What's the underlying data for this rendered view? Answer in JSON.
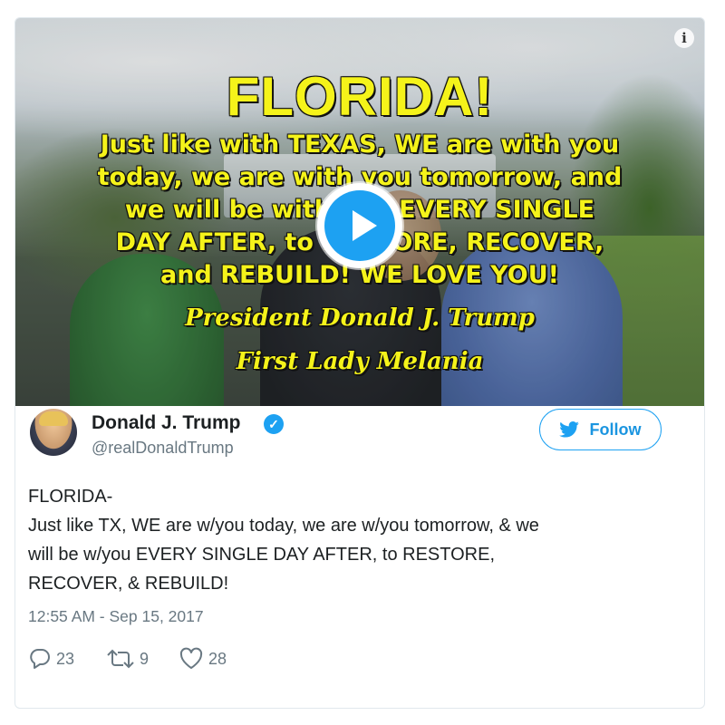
{
  "media": {
    "overlay_title": "FLORIDA!",
    "overlay_lines": [
      "Just like with TEXAS, WE are with you",
      "today, we are with you tomorrow, and",
      "we will be with you EVERY SINGLE",
      "DAY AFTER, to RESTORE, RECOVER,",
      "and REBUILD! WE LOVE YOU!"
    ],
    "overlay_signatures": [
      "President Donald J. Trump",
      "First Lady Melania"
    ],
    "info_icon": "info-icon",
    "play_icon": "play-icon"
  },
  "author": {
    "display_name": "Donald J. Trump",
    "handle": "@realDonaldTrump",
    "verified_icon": "verified-badge-icon",
    "avatar_icon": "avatar"
  },
  "follow_button": {
    "label": "Follow",
    "icon": "twitter-bird-icon"
  },
  "tweet": {
    "lines": [
      "FLORIDA-",
      "Just like TX, WE are w/you today, we are w/you tomorrow, & we",
      "will be w/you EVERY SINGLE DAY AFTER, to RESTORE,",
      "RECOVER, & REBUILD!"
    ],
    "timestamp": "12:55 AM - Sep 15, 2017"
  },
  "actions": {
    "reply_count": "23",
    "retweet_count": "9",
    "like_count": "28"
  },
  "colors": {
    "accent": "#1da1f2",
    "overlay_text": "#f5f31a",
    "muted_text": "#697882",
    "border": "#e1e8ed"
  }
}
